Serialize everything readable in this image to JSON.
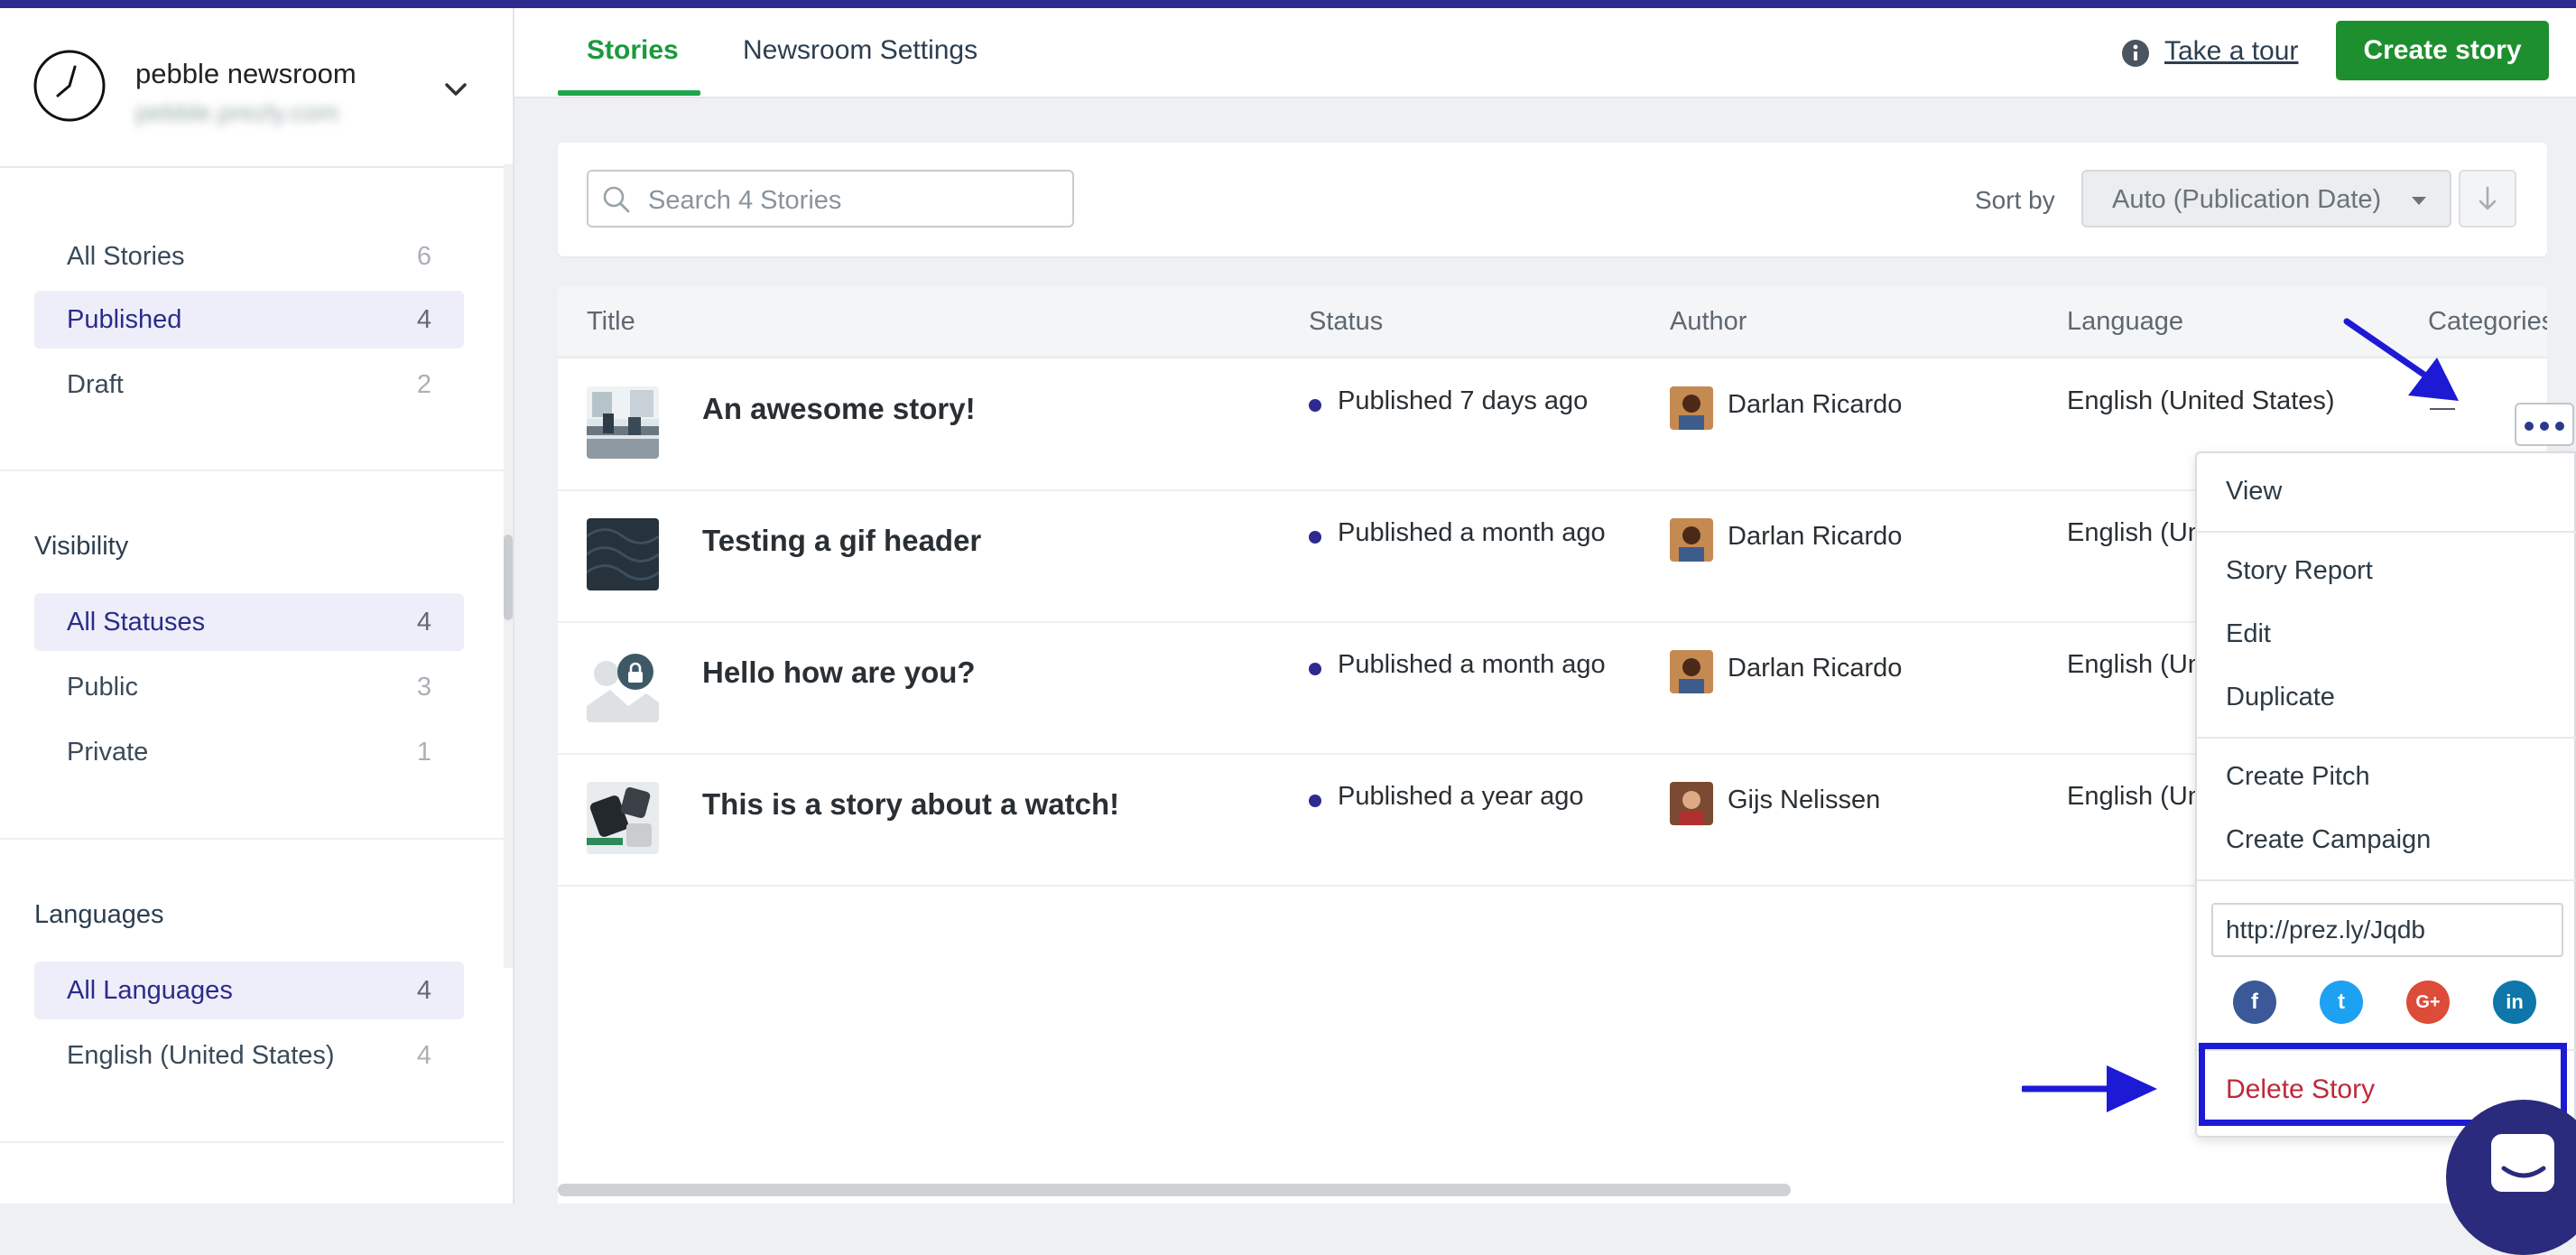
{
  "brand": {
    "name": "pebble newsroom",
    "url": "pebble.prezly.com"
  },
  "sidebar": {
    "stories": [
      {
        "label": "All Stories",
        "count": "6"
      },
      {
        "label": "Published",
        "count": "4"
      },
      {
        "label": "Draft",
        "count": "2"
      }
    ],
    "visibility_heading": "Visibility",
    "visibility": [
      {
        "label": "All Statuses",
        "count": "4"
      },
      {
        "label": "Public",
        "count": "3"
      },
      {
        "label": "Private",
        "count": "1"
      }
    ],
    "languages_heading": "Languages",
    "languages": [
      {
        "label": "All Languages",
        "count": "4"
      },
      {
        "label": "English (United States)",
        "count": "4"
      }
    ]
  },
  "header": {
    "tabs": [
      {
        "label": "Stories"
      },
      {
        "label": "Newsroom Settings"
      }
    ],
    "tour_label": "Take a tour",
    "create_label": "Create story"
  },
  "search": {
    "placeholder": "Search 4 Stories"
  },
  "sort": {
    "label": "Sort by",
    "value": "Auto (Publication Date)"
  },
  "table": {
    "columns": {
      "title": "Title",
      "status": "Status",
      "author": "Author",
      "language": "Language",
      "categories": "Categories"
    },
    "rows": [
      {
        "title": "An awesome story!",
        "status": "Published 7 days ago",
        "author": "Darlan Ricardo",
        "language": "English (United States)",
        "categories": "—"
      },
      {
        "title": "Testing a gif header",
        "status": "Published a month ago",
        "author": "Darlan Ricardo",
        "language": "English (Un"
      },
      {
        "title": "Hello how are you?",
        "status": "Published a month ago",
        "author": "Darlan Ricardo",
        "language": "English (Un"
      },
      {
        "title": "This is a story about a watch!",
        "status": "Published a year ago",
        "author": "Gijs Nelissen",
        "language": "English (Un"
      }
    ]
  },
  "menu": {
    "view": "View",
    "story_report": "Story Report",
    "edit": "Edit",
    "duplicate": "Duplicate",
    "create_pitch": "Create Pitch",
    "create_campaign": "Create Campaign",
    "short_url": "http://prez.ly/Jqdb",
    "share": {
      "facebook": "f",
      "twitter": "t",
      "google": "G+",
      "linkedin": "in"
    },
    "delete": "Delete Story"
  },
  "colors": {
    "accent": "#1fa64a",
    "create_button": "#1e8f2e",
    "brand_navy": "#2e2a8e",
    "danger": "#c0283a",
    "annotation": "#1d1ad6"
  }
}
